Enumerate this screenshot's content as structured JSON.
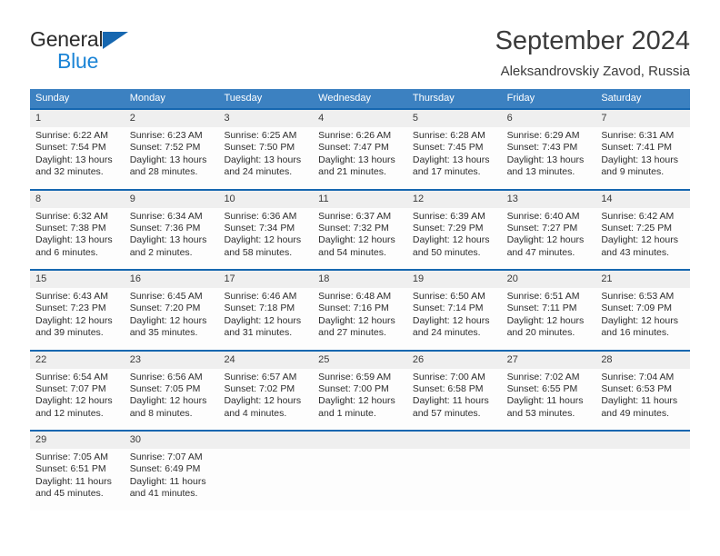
{
  "logo": {
    "primary_text": "General",
    "secondary_text": "Blue",
    "primary_color": "#2b2b2b",
    "secondary_color": "#1b84d6",
    "triangle_color": "#1667b0"
  },
  "header": {
    "title": "September 2024",
    "subtitle": "Aleksandrovskiy Zavod, Russia"
  },
  "theme": {
    "header_bg": "#3c81c1",
    "row_border": "#1667b0",
    "date_band_bg": "#efefef",
    "cell_bg": "#fdfdfd",
    "text_color": "#2d2d2d"
  },
  "weekdays": [
    "Sunday",
    "Monday",
    "Tuesday",
    "Wednesday",
    "Thursday",
    "Friday",
    "Saturday"
  ],
  "weeks": [
    [
      {
        "date": "1",
        "sunrise": "Sunrise: 6:22 AM",
        "sunset": "Sunset: 7:54 PM",
        "daylight_line1": "Daylight: 13 hours",
        "daylight_line2": "and 32 minutes."
      },
      {
        "date": "2",
        "sunrise": "Sunrise: 6:23 AM",
        "sunset": "Sunset: 7:52 PM",
        "daylight_line1": "Daylight: 13 hours",
        "daylight_line2": "and 28 minutes."
      },
      {
        "date": "3",
        "sunrise": "Sunrise: 6:25 AM",
        "sunset": "Sunset: 7:50 PM",
        "daylight_line1": "Daylight: 13 hours",
        "daylight_line2": "and 24 minutes."
      },
      {
        "date": "4",
        "sunrise": "Sunrise: 6:26 AM",
        "sunset": "Sunset: 7:47 PM",
        "daylight_line1": "Daylight: 13 hours",
        "daylight_line2": "and 21 minutes."
      },
      {
        "date": "5",
        "sunrise": "Sunrise: 6:28 AM",
        "sunset": "Sunset: 7:45 PM",
        "daylight_line1": "Daylight: 13 hours",
        "daylight_line2": "and 17 minutes."
      },
      {
        "date": "6",
        "sunrise": "Sunrise: 6:29 AM",
        "sunset": "Sunset: 7:43 PM",
        "daylight_line1": "Daylight: 13 hours",
        "daylight_line2": "and 13 minutes."
      },
      {
        "date": "7",
        "sunrise": "Sunrise: 6:31 AM",
        "sunset": "Sunset: 7:41 PM",
        "daylight_line1": "Daylight: 13 hours",
        "daylight_line2": "and 9 minutes."
      }
    ],
    [
      {
        "date": "8",
        "sunrise": "Sunrise: 6:32 AM",
        "sunset": "Sunset: 7:38 PM",
        "daylight_line1": "Daylight: 13 hours",
        "daylight_line2": "and 6 minutes."
      },
      {
        "date": "9",
        "sunrise": "Sunrise: 6:34 AM",
        "sunset": "Sunset: 7:36 PM",
        "daylight_line1": "Daylight: 13 hours",
        "daylight_line2": "and 2 minutes."
      },
      {
        "date": "10",
        "sunrise": "Sunrise: 6:36 AM",
        "sunset": "Sunset: 7:34 PM",
        "daylight_line1": "Daylight: 12 hours",
        "daylight_line2": "and 58 minutes."
      },
      {
        "date": "11",
        "sunrise": "Sunrise: 6:37 AM",
        "sunset": "Sunset: 7:32 PM",
        "daylight_line1": "Daylight: 12 hours",
        "daylight_line2": "and 54 minutes."
      },
      {
        "date": "12",
        "sunrise": "Sunrise: 6:39 AM",
        "sunset": "Sunset: 7:29 PM",
        "daylight_line1": "Daylight: 12 hours",
        "daylight_line2": "and 50 minutes."
      },
      {
        "date": "13",
        "sunrise": "Sunrise: 6:40 AM",
        "sunset": "Sunset: 7:27 PM",
        "daylight_line1": "Daylight: 12 hours",
        "daylight_line2": "and 47 minutes."
      },
      {
        "date": "14",
        "sunrise": "Sunrise: 6:42 AM",
        "sunset": "Sunset: 7:25 PM",
        "daylight_line1": "Daylight: 12 hours",
        "daylight_line2": "and 43 minutes."
      }
    ],
    [
      {
        "date": "15",
        "sunrise": "Sunrise: 6:43 AM",
        "sunset": "Sunset: 7:23 PM",
        "daylight_line1": "Daylight: 12 hours",
        "daylight_line2": "and 39 minutes."
      },
      {
        "date": "16",
        "sunrise": "Sunrise: 6:45 AM",
        "sunset": "Sunset: 7:20 PM",
        "daylight_line1": "Daylight: 12 hours",
        "daylight_line2": "and 35 minutes."
      },
      {
        "date": "17",
        "sunrise": "Sunrise: 6:46 AM",
        "sunset": "Sunset: 7:18 PM",
        "daylight_line1": "Daylight: 12 hours",
        "daylight_line2": "and 31 minutes."
      },
      {
        "date": "18",
        "sunrise": "Sunrise: 6:48 AM",
        "sunset": "Sunset: 7:16 PM",
        "daylight_line1": "Daylight: 12 hours",
        "daylight_line2": "and 27 minutes."
      },
      {
        "date": "19",
        "sunrise": "Sunrise: 6:50 AM",
        "sunset": "Sunset: 7:14 PM",
        "daylight_line1": "Daylight: 12 hours",
        "daylight_line2": "and 24 minutes."
      },
      {
        "date": "20",
        "sunrise": "Sunrise: 6:51 AM",
        "sunset": "Sunset: 7:11 PM",
        "daylight_line1": "Daylight: 12 hours",
        "daylight_line2": "and 20 minutes."
      },
      {
        "date": "21",
        "sunrise": "Sunrise: 6:53 AM",
        "sunset": "Sunset: 7:09 PM",
        "daylight_line1": "Daylight: 12 hours",
        "daylight_line2": "and 16 minutes."
      }
    ],
    [
      {
        "date": "22",
        "sunrise": "Sunrise: 6:54 AM",
        "sunset": "Sunset: 7:07 PM",
        "daylight_line1": "Daylight: 12 hours",
        "daylight_line2": "and 12 minutes."
      },
      {
        "date": "23",
        "sunrise": "Sunrise: 6:56 AM",
        "sunset": "Sunset: 7:05 PM",
        "daylight_line1": "Daylight: 12 hours",
        "daylight_line2": "and 8 minutes."
      },
      {
        "date": "24",
        "sunrise": "Sunrise: 6:57 AM",
        "sunset": "Sunset: 7:02 PM",
        "daylight_line1": "Daylight: 12 hours",
        "daylight_line2": "and 4 minutes."
      },
      {
        "date": "25",
        "sunrise": "Sunrise: 6:59 AM",
        "sunset": "Sunset: 7:00 PM",
        "daylight_line1": "Daylight: 12 hours",
        "daylight_line2": "and 1 minute."
      },
      {
        "date": "26",
        "sunrise": "Sunrise: 7:00 AM",
        "sunset": "Sunset: 6:58 PM",
        "daylight_line1": "Daylight: 11 hours",
        "daylight_line2": "and 57 minutes."
      },
      {
        "date": "27",
        "sunrise": "Sunrise: 7:02 AM",
        "sunset": "Sunset: 6:55 PM",
        "daylight_line1": "Daylight: 11 hours",
        "daylight_line2": "and 53 minutes."
      },
      {
        "date": "28",
        "sunrise": "Sunrise: 7:04 AM",
        "sunset": "Sunset: 6:53 PM",
        "daylight_line1": "Daylight: 11 hours",
        "daylight_line2": "and 49 minutes."
      }
    ],
    [
      {
        "date": "29",
        "sunrise": "Sunrise: 7:05 AM",
        "sunset": "Sunset: 6:51 PM",
        "daylight_line1": "Daylight: 11 hours",
        "daylight_line2": "and 45 minutes."
      },
      {
        "date": "30",
        "sunrise": "Sunrise: 7:07 AM",
        "sunset": "Sunset: 6:49 PM",
        "daylight_line1": "Daylight: 11 hours",
        "daylight_line2": "and 41 minutes."
      },
      {
        "date": "",
        "sunrise": "",
        "sunset": "",
        "daylight_line1": "",
        "daylight_line2": ""
      },
      {
        "date": "",
        "sunrise": "",
        "sunset": "",
        "daylight_line1": "",
        "daylight_line2": ""
      },
      {
        "date": "",
        "sunrise": "",
        "sunset": "",
        "daylight_line1": "",
        "daylight_line2": ""
      },
      {
        "date": "",
        "sunrise": "",
        "sunset": "",
        "daylight_line1": "",
        "daylight_line2": ""
      },
      {
        "date": "",
        "sunrise": "",
        "sunset": "",
        "daylight_line1": "",
        "daylight_line2": ""
      }
    ]
  ]
}
